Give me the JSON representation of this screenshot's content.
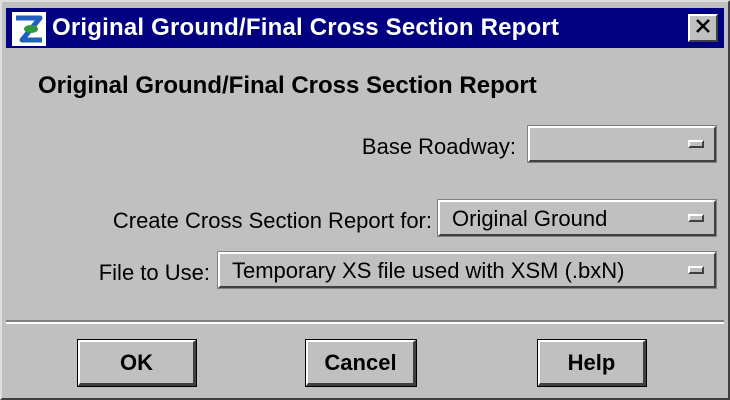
{
  "window": {
    "title": "Original Ground/Final Cross Section Report",
    "close_label": "✕"
  },
  "heading": "Original Ground/Final Cross Section Report",
  "fields": {
    "base_roadway": {
      "label": "Base Roadway:",
      "value": ""
    },
    "report_for": {
      "label": "Create Cross Section Report for:",
      "value": "Original Ground"
    },
    "file_to_use": {
      "label": "File to Use:",
      "value": "Temporary XS file used with XSM (.bxN)"
    }
  },
  "buttons": {
    "ok": "OK",
    "cancel": "Cancel",
    "help": "Help"
  },
  "colors": {
    "titlebar": "#000080",
    "face": "#c0c0c0",
    "icon_blue": "#1f5fbf",
    "icon_green": "#2f9a3a"
  },
  "icons": {
    "app": "app-logo-icon",
    "close": "close-icon",
    "dropdown": "option-menu-indicator-icon"
  }
}
